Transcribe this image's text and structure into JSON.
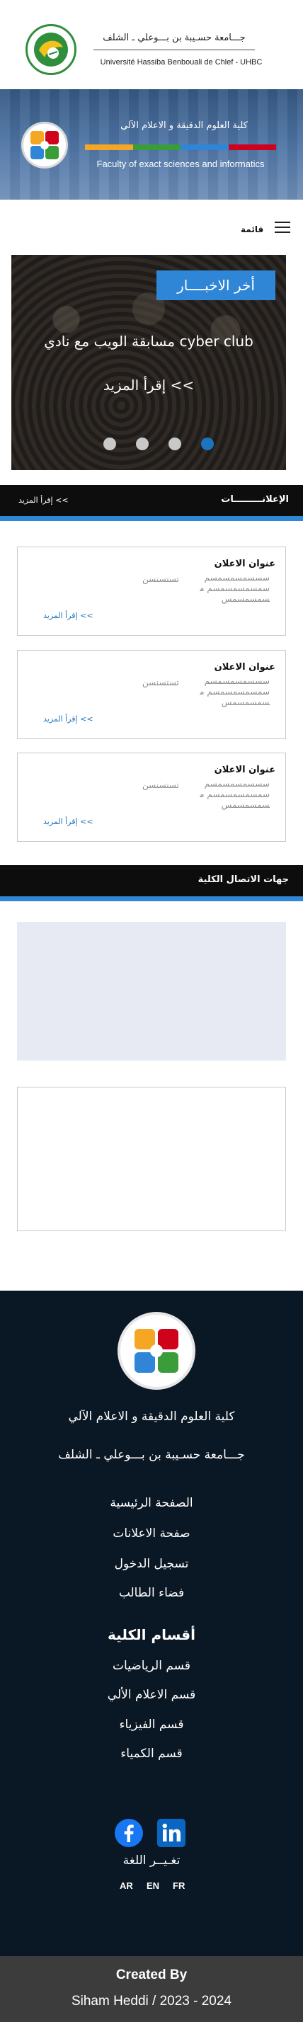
{
  "header": {
    "university_ar": "جـــامعة حسـيبة بن بـــوعلي ـ الشلف",
    "university_fr": "Université Hassiba Benbouali de Chlef - UHBC"
  },
  "banner": {
    "faculty_ar": "كلية العلوم الدقيقة و الاعلام الآلي",
    "faculty_en": "Faculty of exact sciences and informatics",
    "stripe_colors": [
      "#f5a623",
      "#3a9d3a",
      "#2f86d6",
      "#d0021b"
    ]
  },
  "menu": {
    "label": "قائمة",
    "icon": "hamburger-icon"
  },
  "news": {
    "badge": "أخر الاخبــــار",
    "title": "مسابقة الويب مع نادي cyber club",
    "more": "إقرأ المزيد <<",
    "dots": 4,
    "active_dot": 3
  },
  "announcements": {
    "title": "الإعلانـــــــــات",
    "more_link": "إقرأ المزيد <<",
    "items": [
      {
        "title": "عنوان الاعلان",
        "body": "سسسمسمسمسم سمسمسمسمسم مسمسمسمس",
        "side": "تستسنسن",
        "more": "إقرأ المزيد <<"
      },
      {
        "title": "عنوان الاعلان",
        "body": "سسسمسمسمسم سمسمسمسمسم مسمسمسمس",
        "side": "تستسنسن",
        "more": "إقرأ المزيد <<"
      },
      {
        "title": "عنوان الاعلان",
        "body": "سسسمسمسمسم سمسمسمسمسم مسمسمسمس",
        "side": "تستسنسن",
        "more": "إقرأ المزيد <<"
      }
    ]
  },
  "contacts": {
    "title": "جهات الاتصال الكلية"
  },
  "footer": {
    "faculty_ar": "كلية العلوم الدقيقة و الاعلام الآلي",
    "university_ar": "جـــامعة حسـيبة بن بـــوعلي ـ الشلف",
    "links": [
      "الصفحة الرئيسية",
      "صفحة الاعلانات",
      "تسجيل الدخول",
      "فضاء الطالب"
    ],
    "departments_title": "أقسام الكلية",
    "departments": [
      "قسم الرياضيات",
      "قسم الاعلام الألي",
      "قسم الفيزياء",
      "قسم الكمياء"
    ],
    "social": [
      {
        "icon": "facebook-icon",
        "color": "#1877f2"
      },
      {
        "icon": "linkedin-icon",
        "color": "#0a66c2"
      }
    ],
    "change_language": "تغـيــر اللغة",
    "languages": [
      "AR",
      "EN",
      "FR"
    ]
  },
  "credit": {
    "label": "Created By",
    "author": "Siham Heddi / 2023 - 2024"
  }
}
